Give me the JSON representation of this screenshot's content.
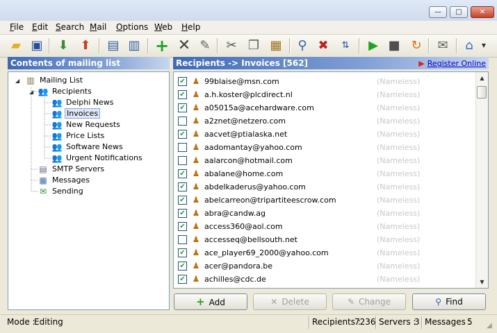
{
  "window": {
    "minimize": "—",
    "maximize": "□",
    "close": "✕"
  },
  "menu": [
    "File",
    "Edit",
    "Search",
    "Mail",
    "Options",
    "Web",
    "Help"
  ],
  "menu_access": [
    "F",
    "E",
    "S",
    "M",
    "O",
    "W",
    "H"
  ],
  "toolbar_icons": [
    "open-folder-icon",
    "save-icon",
    "import-icon",
    "export-icon",
    "add-recipient-icon",
    "recipient-card-icon",
    "add-icon",
    "delete-icon",
    "edit-icon",
    "cut-icon",
    "copy-icon",
    "paste-icon",
    "search-icon",
    "remove-icon",
    "sort-az-icon",
    "play-icon",
    "stop-icon",
    "refresh-icon",
    "mail-icon",
    "home-icon"
  ],
  "left_panel": {
    "title": "Contents of mailing list"
  },
  "tree": [
    {
      "label": "Mailing List",
      "level": 0
    },
    {
      "label": "Recipients",
      "level": 1
    },
    {
      "label": "Delphi News",
      "level": 2
    },
    {
      "label": "Invoices",
      "level": 2,
      "selected": true
    },
    {
      "label": "New Requests",
      "level": 2
    },
    {
      "label": "Price Lists",
      "level": 2
    },
    {
      "label": "Software News",
      "level": 2
    },
    {
      "label": "Urgent Notifications",
      "level": 2
    },
    {
      "label": "SMTP Servers",
      "level": 1
    },
    {
      "label": "Messages",
      "level": 1
    },
    {
      "label": "Sending",
      "level": 1
    }
  ],
  "right_panel": {
    "title": "Recipients -> Invoices [562]",
    "register_link": "Register Online"
  },
  "recipients": [
    {
      "email": "99blaise@msn.com",
      "checked": true,
      "name": "(Nameless)"
    },
    {
      "email": "a.h.koster@plcdirect.nl",
      "checked": true,
      "name": "(Nameless)"
    },
    {
      "email": "a05015a@acehardware.com",
      "checked": true,
      "name": "(Nameless)"
    },
    {
      "email": "a2znet@netzero.com",
      "checked": false,
      "name": "(Nameless)"
    },
    {
      "email": "aacvet@ptialaska.net",
      "checked": true,
      "name": "(Nameless)"
    },
    {
      "email": "aadomantay@yahoo.com",
      "checked": false,
      "name": "(Nameless)"
    },
    {
      "email": "aalarcon@hotmail.com",
      "checked": false,
      "name": "(Nameless)"
    },
    {
      "email": "abalane@home.com",
      "checked": true,
      "name": "(Nameless)"
    },
    {
      "email": "abdelkaderus@yahoo.com",
      "checked": true,
      "name": "(Nameless)"
    },
    {
      "email": "abelcarreon@tripartiteescrow.com",
      "checked": true,
      "name": "(Nameless)"
    },
    {
      "email": "abra@candw.ag",
      "checked": true,
      "name": "(Nameless)"
    },
    {
      "email": "access360@aol.com",
      "checked": true,
      "name": "(Nameless)"
    },
    {
      "email": "accesseq@bellsouth.net",
      "checked": false,
      "name": "(Nameless)"
    },
    {
      "email": "ace_player69_2000@yahoo.com",
      "checked": true,
      "name": "(Nameless)"
    },
    {
      "email": "acer@pandora.be",
      "checked": true,
      "name": "(Nameless)"
    },
    {
      "email": "achilles@cdc.de",
      "checked": true,
      "name": "(Nameless)"
    }
  ],
  "buttons": {
    "add": "Add",
    "delete": "Delete",
    "change": "Change",
    "find": "Find"
  },
  "status": {
    "mode_label": "Mode :",
    "mode_value": "Editing",
    "recipients_label": "Recipients :",
    "recipients_value": "7236",
    "servers_label": "Servers :",
    "servers_value": "3",
    "messages_label": "Messages :",
    "messages_value": "5"
  }
}
